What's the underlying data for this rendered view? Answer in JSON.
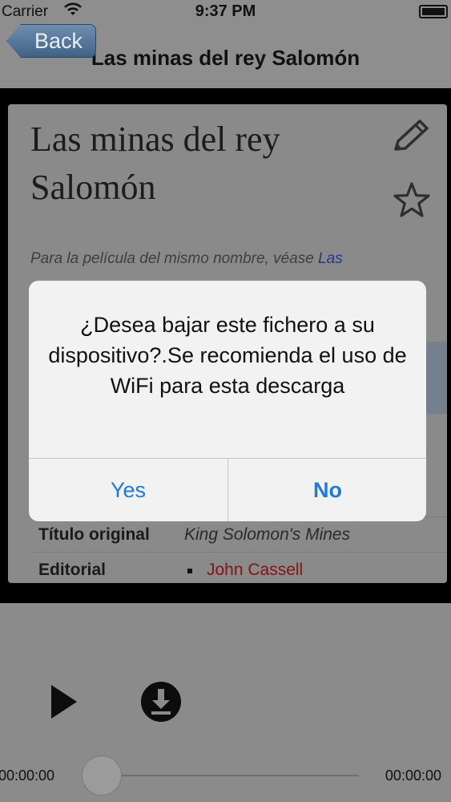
{
  "status_bar": {
    "carrier": "Carrier",
    "time": "9:37 PM"
  },
  "nav": {
    "back_label": "Back",
    "title": "Las minas del rey Salomón"
  },
  "article": {
    "title": "Las minas del rey Salomón",
    "hatnote_text": "Para la película del mismo nombre, véase ",
    "hatnote_link": "Las",
    "rows": [
      {
        "key": "Título original",
        "value": "King Solomon's Mines"
      },
      {
        "key": "Editorial",
        "value": "John Cassell"
      }
    ]
  },
  "alert": {
    "message": "¿Desea bajar este fichero a su dispositivo?.Se recomienda el uso de WiFi para esta descarga",
    "yes_label": "Yes",
    "no_label": "No"
  },
  "player": {
    "current_time": "00:00:00",
    "duration": "00:00:00",
    "progress": 0
  },
  "icons": {
    "edit": "pencil-icon",
    "favorite": "star-icon",
    "play": "play-icon",
    "download": "download-icon",
    "wifi": "wifi-icon",
    "battery": "battery-icon"
  },
  "colors": {
    "alert_button": "#1f7ae0",
    "link": "#25358a",
    "red_link": "#7f1614",
    "back_button": "#4f7196"
  }
}
